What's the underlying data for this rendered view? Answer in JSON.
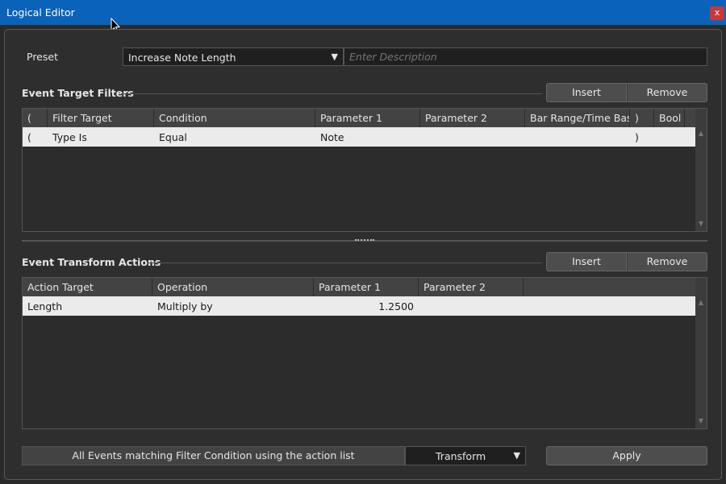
{
  "window": {
    "title": "Logical Editor",
    "close_label": "x"
  },
  "preset": {
    "label": "Preset",
    "value": "Increase Note Length",
    "description_placeholder": "Enter Description"
  },
  "filters": {
    "title": "Event Target Filters",
    "insert_label": "Insert",
    "remove_label": "Remove",
    "columns": [
      "(",
      "Filter Target",
      "Condition",
      "Parameter 1",
      "Parameter 2",
      "Bar Range/Time Base",
      ")",
      "Bool"
    ],
    "rows": [
      [
        "(",
        "Type Is",
        "Equal",
        "Note",
        "",
        "",
        ")",
        ""
      ]
    ]
  },
  "actions": {
    "title": "Event Transform Actions",
    "insert_label": "Insert",
    "remove_label": "Remove",
    "columns": [
      "Action Target",
      "Operation",
      "Parameter 1",
      "Parameter 2"
    ],
    "rows": [
      [
        "Length",
        "Multiply by",
        "1.2500",
        ""
      ]
    ]
  },
  "footer": {
    "status": "All Events matching Filter Condition using the action list",
    "mode": "Transform",
    "apply_label": "Apply"
  }
}
